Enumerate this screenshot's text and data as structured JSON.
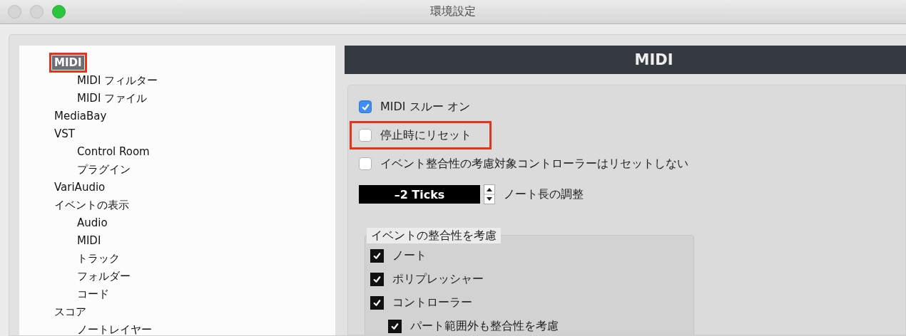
{
  "window": {
    "title": "環境設定"
  },
  "sidebar": {
    "items": [
      {
        "label": "MIDI",
        "selected": true,
        "annotated": true,
        "children": [
          {
            "label": "MIDI フィルター",
            "selected": false
          },
          {
            "label": "MIDI ファイル",
            "selected": false
          }
        ]
      },
      {
        "label": "MediaBay",
        "selected": false
      },
      {
        "label": "VST",
        "selected": false,
        "children": [
          {
            "label": "Control Room",
            "selected": false
          },
          {
            "label": "プラグイン",
            "selected": false
          }
        ]
      },
      {
        "label": "VariAudio",
        "selected": false
      },
      {
        "label": "イベントの表示",
        "selected": false,
        "children": [
          {
            "label": "Audio",
            "selected": false
          },
          {
            "label": "MIDI",
            "selected": false
          },
          {
            "label": "トラック",
            "selected": false
          },
          {
            "label": "フォルダー",
            "selected": false
          },
          {
            "label": "コード",
            "selected": false
          }
        ]
      },
      {
        "label": "スコア",
        "selected": false,
        "children": [
          {
            "label": "ノートレイヤー",
            "selected": false
          }
        ]
      }
    ]
  },
  "panel": {
    "title": "MIDI",
    "options": [
      {
        "label": "MIDI スルー オン",
        "checked": true,
        "annotated": false
      },
      {
        "label": "停止時にリセット",
        "checked": false,
        "annotated": true
      },
      {
        "label": "イベント整合性の考慮対象コントローラーはリセットしない",
        "checked": false,
        "annotated": false
      }
    ],
    "spinner": {
      "value": "–2 Ticks",
      "label": "ノート長の調整"
    },
    "group": {
      "title": "イベントの整合性を考慮",
      "items": [
        {
          "label": "ノート",
          "checked": true
        },
        {
          "label": "ポリプレッシャー",
          "checked": true
        },
        {
          "label": "コントローラー",
          "checked": true,
          "children": [
            {
              "label": "パート範囲外も整合性を考慮",
              "checked": true
            }
          ]
        }
      ]
    }
  }
}
